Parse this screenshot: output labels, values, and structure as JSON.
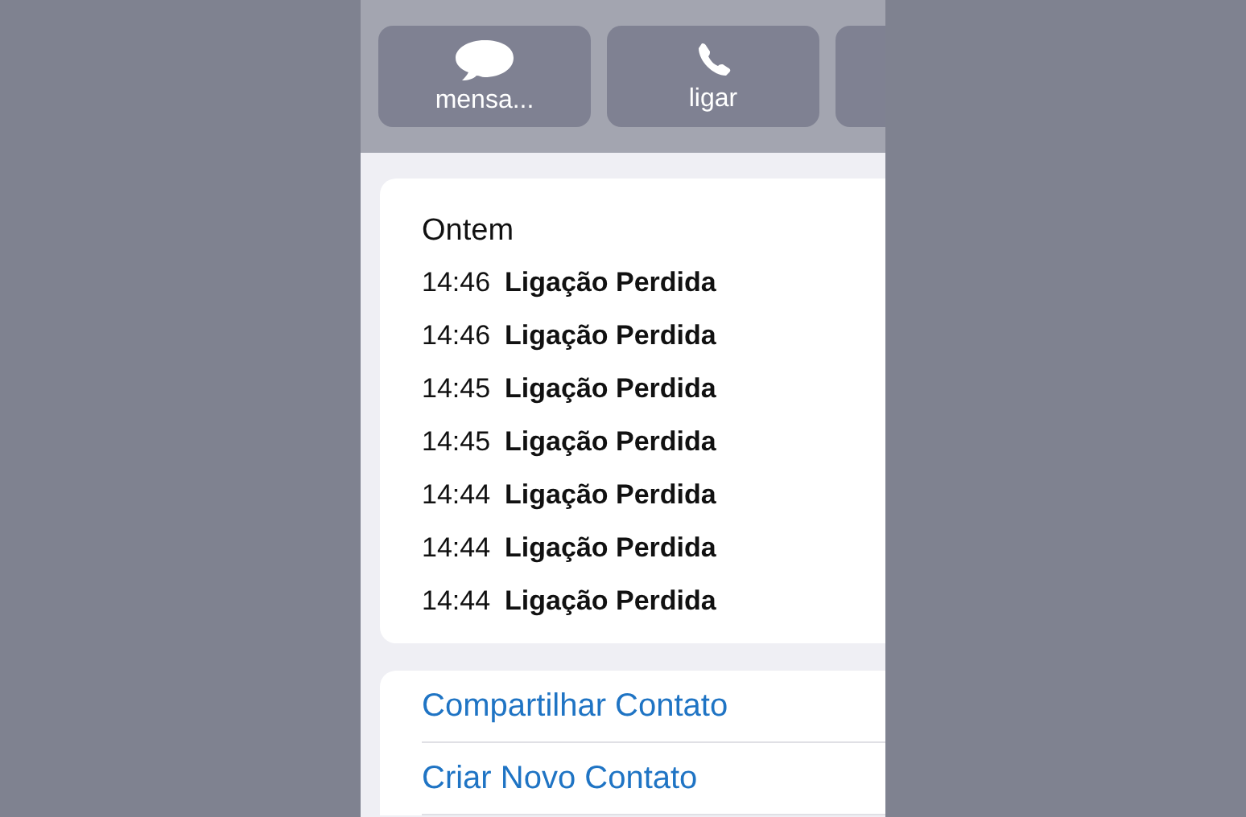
{
  "action_buttons": [
    {
      "kind": "message",
      "label": "mensa..."
    },
    {
      "kind": "phone",
      "label": "ligar"
    },
    {
      "kind": "clipped"
    }
  ],
  "call_history": {
    "heading": "Ontem",
    "calls": [
      {
        "time": "14:46",
        "status": "Ligação Perdida"
      },
      {
        "time": "14:46",
        "status": "Ligação Perdida"
      },
      {
        "time": "14:45",
        "status": "Ligação Perdida"
      },
      {
        "time": "14:45",
        "status": "Ligação Perdida"
      },
      {
        "time": "14:44",
        "status": "Ligação Perdida"
      },
      {
        "time": "14:44",
        "status": "Ligação Perdida"
      },
      {
        "time": "14:44",
        "status": "Ligação Perdida"
      }
    ]
  },
  "actions": [
    "Compartilhar Contato",
    "Criar Novo Contato"
  ]
}
